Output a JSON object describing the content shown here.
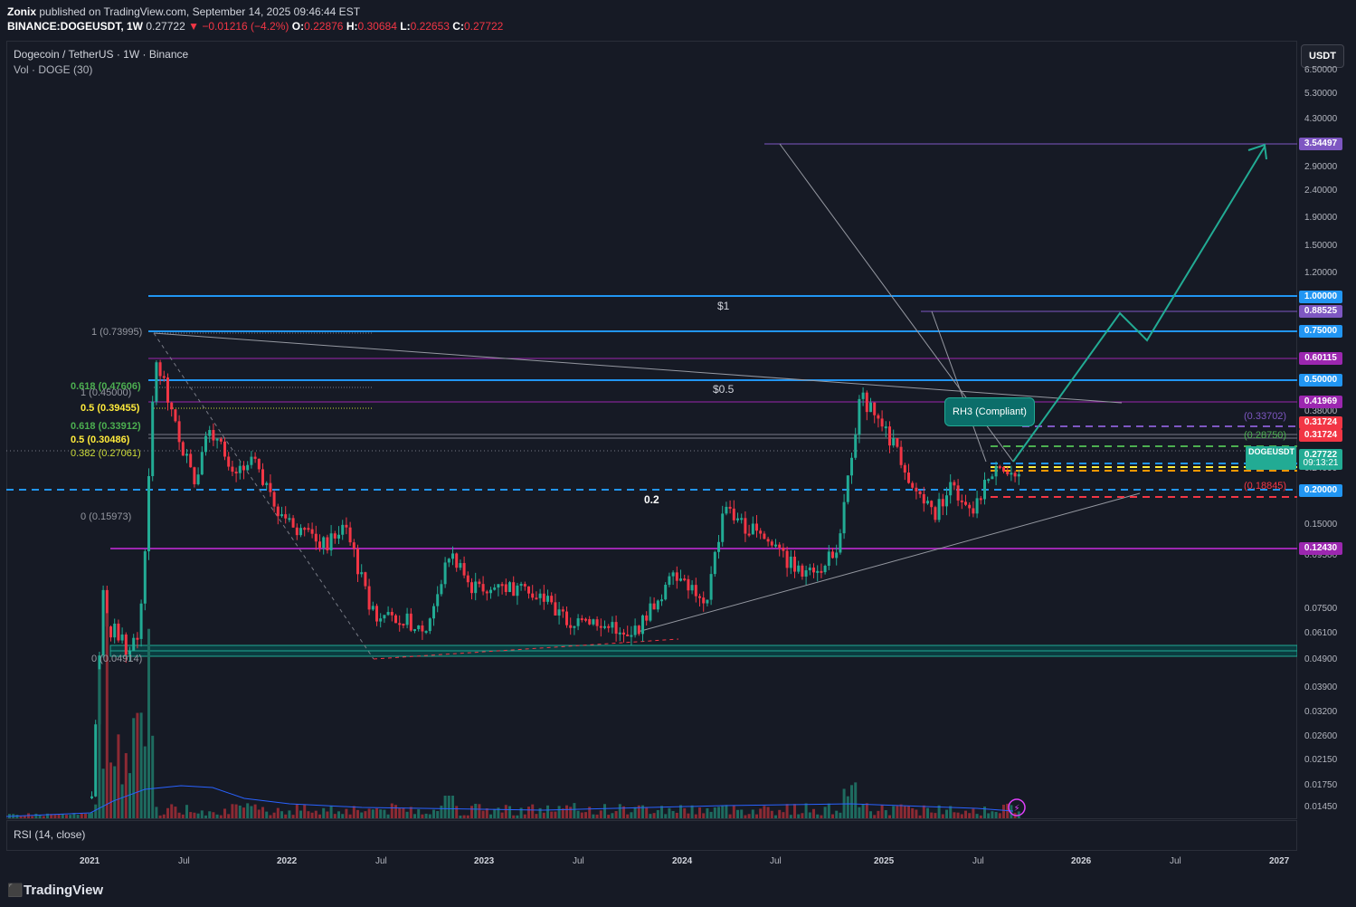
{
  "header": {
    "author": "Zonix",
    "published_text": "published on TradingView.com, September 14, 2025 09:46:44 EST",
    "symbol_line": "BINANCE:DOGEUSDT, 1W",
    "last": "0.27722",
    "change": "−0.01216 (−4.2%)",
    "o_label": "O:",
    "o": "0.22876",
    "h_label": "H:",
    "h": "0.30684",
    "l_label": "L:",
    "l": "0.22653",
    "c_label": "C:",
    "c": "0.27722"
  },
  "legend": {
    "title": "Dogecoin / TetherUS · 1W · Binance",
    "volume": "Vol · DOGE (30)",
    "rsi": "RSI (14, close)"
  },
  "currency_button": "USDT",
  "price_axis_ticks": [
    "6.50000",
    "5.30000",
    "4.30000",
    "2.90000",
    "2.40000",
    "1.90000",
    "1.50000",
    "1.20000",
    "0.38000",
    "0.24000",
    "0.15000",
    "0.09500",
    "0.07500",
    "0.06100",
    "0.04900",
    "0.03900",
    "0.03200",
    "0.02600",
    "0.02150",
    "0.01750",
    "0.01450"
  ],
  "price_tags": [
    {
      "value": "3.54497",
      "color": "#7e57c2"
    },
    {
      "value": "1.00000",
      "color": "#2196f3"
    },
    {
      "value": "0.88525",
      "color": "#7e57c2"
    },
    {
      "value": "0.75000",
      "color": "#2196f3"
    },
    {
      "value": "0.60115",
      "color": "#9c27b0"
    },
    {
      "value": "0.50000",
      "color": "#2196f3"
    },
    {
      "value": "0.41969",
      "color": "#9c27b0"
    },
    {
      "value": "0.31724",
      "color": "#f23645"
    },
    {
      "value": "0.31724",
      "color": "#f23645"
    },
    {
      "value": "0.20000",
      "color": "#2196f3"
    },
    {
      "value": "0.12430",
      "color": "#9c27b0"
    }
  ],
  "symbol_tag": {
    "name": "DOGEUSDT",
    "price": "0.27722",
    "countdown": "09:13:21"
  },
  "fib_labels": {
    "f1": "1 (0.73995)",
    "f2": "0.618 (0.47606)",
    "f3": "1 (0.45000)",
    "f4": "0.5 (0.39455)",
    "f5": "0.618 (0.33912)",
    "f6": "0.5 (0.30486)",
    "f7": "0.382 (0.27061)",
    "f8": "0 (0.15973)",
    "f9": "0 (0.04914)",
    "r1": "(0.33702)",
    "r2": "(0.28750)",
    "r3": "(0.18845)"
  },
  "chart_text": {
    "one_dollar": "$1",
    "half_dollar": "$0.5",
    "point_two": "0.2",
    "callout": "RH3 (Compliant)"
  },
  "time_axis": [
    "2021",
    "Jul",
    "2022",
    "Jul",
    "2023",
    "Jul",
    "2024",
    "Jul",
    "2025",
    "Jul",
    "2026",
    "Jul",
    "2027"
  ],
  "footer": {
    "logo": "TradingView"
  },
  "colors": {
    "up": "#22ab94",
    "down": "#f23645",
    "bg": "#161a25",
    "level_blue": "#2196f3",
    "level_purple": "#9c27b0"
  }
}
